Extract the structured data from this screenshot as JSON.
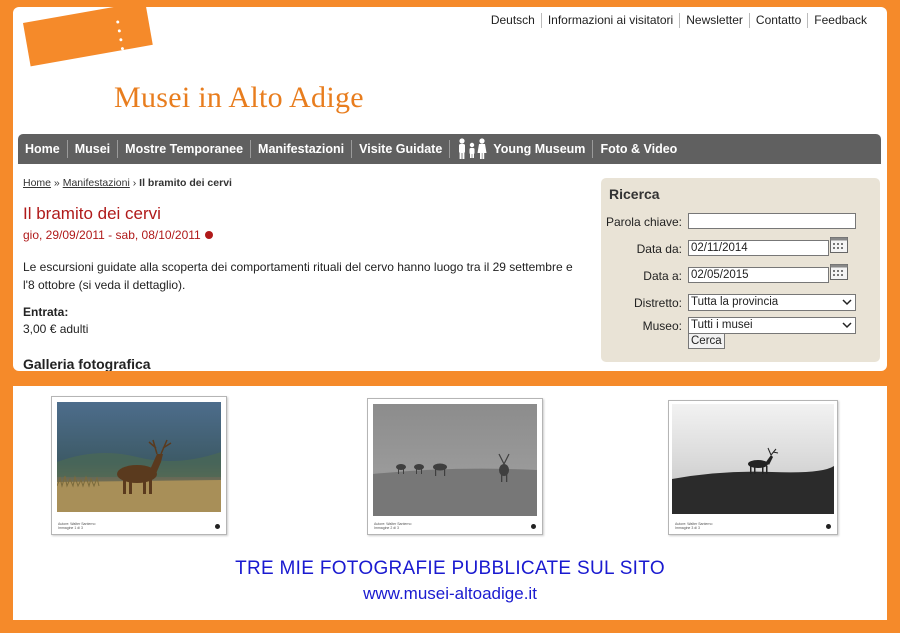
{
  "header": {
    "top_links": [
      "Deutsch",
      "Informazioni ai visitatori",
      "Newsletter",
      "Contatto",
      "Feedback"
    ],
    "site_title": "Musei in Alto Adige",
    "brand_color": "#f58a2a"
  },
  "nav": {
    "items": [
      "Home",
      "Musei",
      "Mostre Temporanee",
      "Manifestazioni",
      "Visite Guidate",
      "Young Museum",
      "Foto & Video"
    ]
  },
  "breadcrumb": {
    "home": "Home",
    "section": "Manifestazioni",
    "current": "Il bramito dei cervi"
  },
  "event": {
    "title": "Il bramito dei cervi",
    "date": "gio, 29/09/2011 - sab, 08/10/2011",
    "description": "Le escursioni guidate alla scoperta dei comportamenti rituali del cervo hanno luogo tra il 29 settembre e l'8 ottobre (si veda il dettaglio).",
    "entrance_label": "Entrata:",
    "entrance_value": "3,00 € adulti",
    "gallery_title": "Galleria fotografica"
  },
  "search": {
    "title": "Ricerca",
    "keyword_label": "Parola chiave:",
    "keyword_value": "",
    "date_from_label": "Data da:",
    "date_from_value": "02/11/2014",
    "date_to_label": "Data a:",
    "date_to_value": "02/05/2015",
    "district_label": "Distretto:",
    "district_value": "Tutta la provincia",
    "museum_label": "Museo:",
    "museum_value": "Tutti i musei",
    "button_label": "Cerca"
  },
  "caption": {
    "line1": "TRE MIE FOTOGRAFIE PUBBLICATE SUL SITO",
    "line2": "www.musei-altoadige.it",
    "color": "#1a1ad0"
  }
}
